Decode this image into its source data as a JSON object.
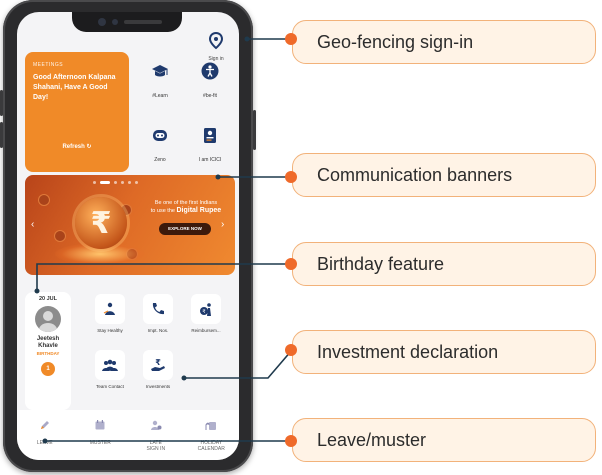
{
  "phone": {
    "signin_label": "Sign in",
    "greeting": {
      "caption": "MEETINGS",
      "message": "Good Afternoon Kalpana Shahani, Have A Good Day!",
      "refresh": "Refresh ↻"
    },
    "quick_tiles": [
      {
        "label": "#Learn",
        "icon": "graduation-cap-icon"
      },
      {
        "label": "#be-fit",
        "icon": "fitness-person-icon"
      },
      {
        "label": "Zeno",
        "icon": "robot-assistant-icon"
      },
      {
        "label": "I am ICICI",
        "icon": "id-badge-icon"
      }
    ],
    "banner": {
      "line1": "Be one of the first Indians",
      "line2_prefix": "to use the ",
      "line2_bold": "Digital Rupee",
      "cta": "EXPLORE NOW",
      "symbol": "₹"
    },
    "birthday": {
      "date": "20 JUL",
      "first_name": "Jeetesh",
      "last_name": "Khavle",
      "tag": "BIRTHDAY",
      "count": "1"
    },
    "services": [
      {
        "label": "Stay Healthy",
        "icon": "healthy-person-icon"
      },
      {
        "label": "Impt. Nos.",
        "icon": "phone-icon"
      },
      {
        "label": "Reimbursem...",
        "icon": "reimbursement-icon"
      },
      {
        "label": "Team Contact",
        "icon": "team-icon"
      },
      {
        "label": "Investments",
        "icon": "investment-hand-icon"
      }
    ],
    "nav": [
      {
        "label": "LEAVE",
        "icon": "pencil-icon"
      },
      {
        "label": "MUSTER",
        "icon": "calendar-icon"
      },
      {
        "label": "LATE\nSIGN IN",
        "icon": "late-signin-icon"
      },
      {
        "label": "HOLIDAY\nCALENDAR",
        "icon": "holiday-calendar-icon"
      }
    ]
  },
  "callouts": [
    {
      "text": "Geo-fencing sign-in"
    },
    {
      "text": "Communication banners"
    },
    {
      "text": "Birthday feature"
    },
    {
      "text": "Investment declaration"
    },
    {
      "text": "Leave/muster"
    }
  ],
  "colors": {
    "accent": "#f08a28",
    "line": "#1f3a4d",
    "callout_bg": "#fff3e6",
    "callout_border": "#f2b27a",
    "dot": "#ef6a2a"
  }
}
